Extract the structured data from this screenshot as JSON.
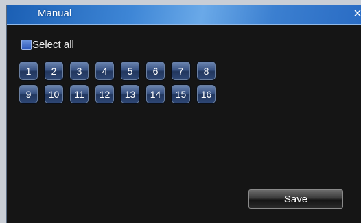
{
  "window": {
    "title": "Manual",
    "close_glyph": "×"
  },
  "select_all": {
    "label": "Select all",
    "checked": true
  },
  "channels": {
    "row1": [
      "1",
      "2",
      "3",
      "4",
      "5",
      "6",
      "7",
      "8"
    ],
    "row2": [
      "9",
      "10",
      "11",
      "12",
      "13",
      "14",
      "15",
      "16"
    ]
  },
  "footer": {
    "save_label": "Save"
  },
  "colors": {
    "title_bar": "#3e86d6",
    "background": "#151515",
    "checkbox": "#2c56b8",
    "channel_button": "#3b5585"
  }
}
